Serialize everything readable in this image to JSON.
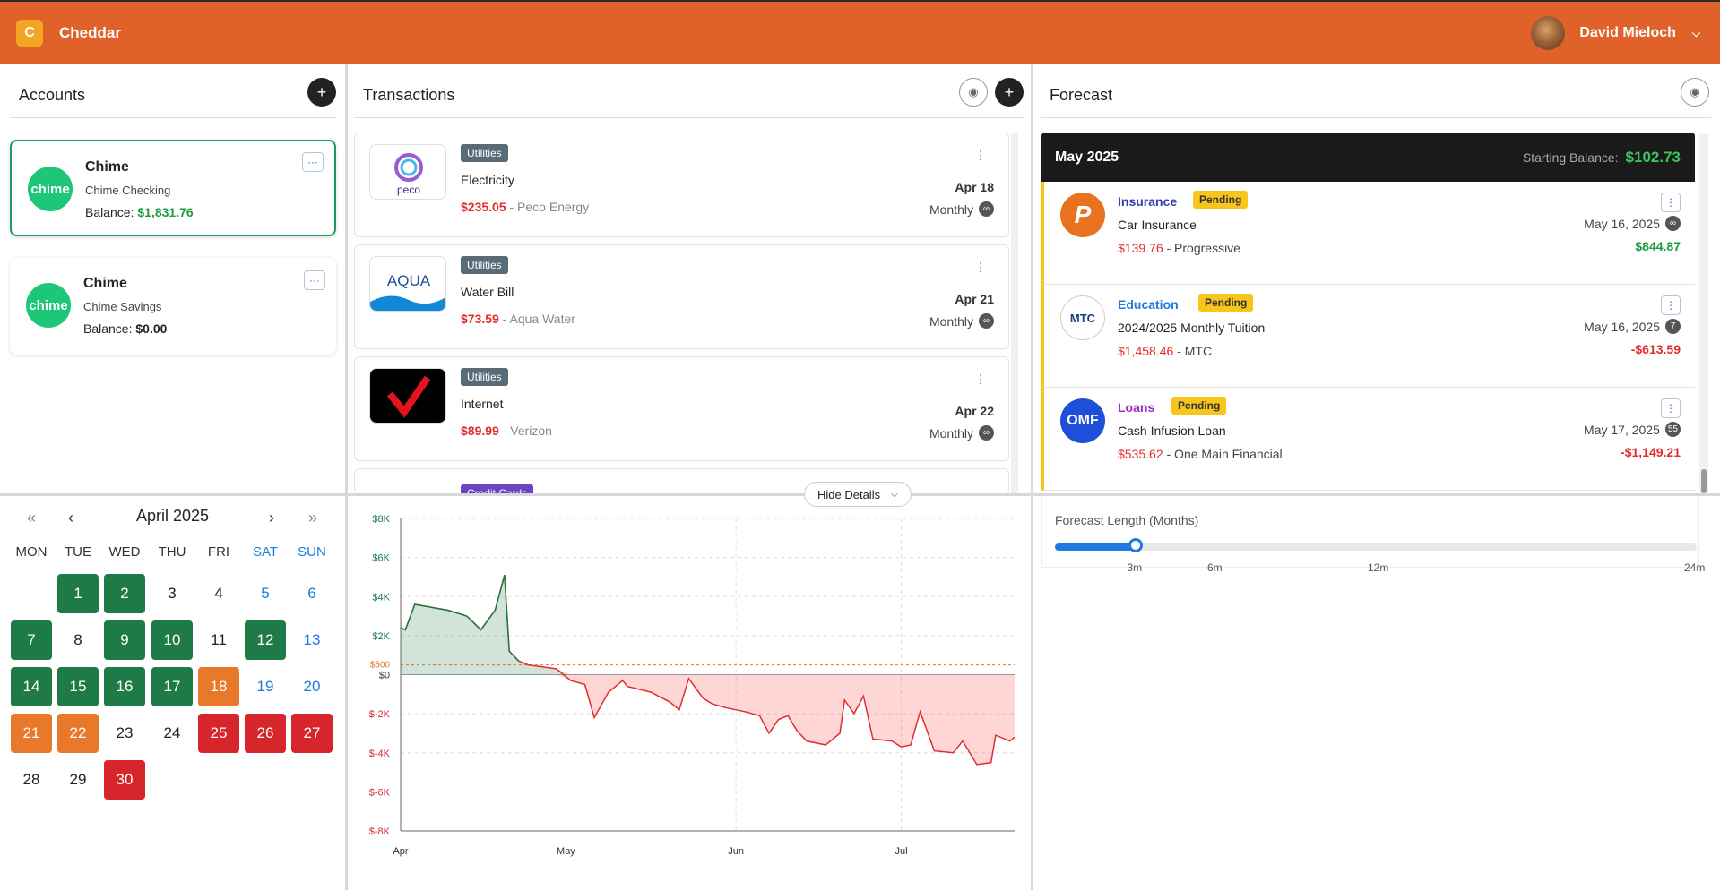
{
  "app": {
    "name": "Cheddar",
    "logo_icon": "cheddar-logo-icon"
  },
  "user": {
    "name": "David Mieloch"
  },
  "accounts": {
    "title": "Accounts",
    "add_label": "+",
    "items": [
      {
        "name": "Chime",
        "logo": "chime",
        "type": "Chime Checking",
        "balance_label": "Balance:",
        "balance": "$1,831.76",
        "selected": true
      },
      {
        "name": "Chime",
        "logo": "chime",
        "type": "Chime Savings",
        "balance_label": "Balance:",
        "balance": "$0.00",
        "selected": false
      }
    ],
    "menu_label": "···"
  },
  "transactions": {
    "title": "Transactions",
    "add_label": "+",
    "items": [
      {
        "logo_text": "peco",
        "category": "Utilities",
        "title": "Electricity",
        "amount": "$235.05",
        "payee": "- Peco Energy",
        "date": "Apr 18",
        "frequency": "Monthly",
        "count": "∞"
      },
      {
        "logo_text": "AQUA",
        "category": "Utilities",
        "title": "Water Bill",
        "amount": "$73.59",
        "payee": "- Aqua Water",
        "date": "Apr 21",
        "frequency": "Monthly",
        "count": "∞"
      },
      {
        "logo_text": "✓",
        "category": "Utilities",
        "title": "Internet",
        "amount": "$89.99",
        "payee": "- Verizon",
        "date": "Apr 22",
        "frequency": "Monthly",
        "count": "∞"
      },
      {
        "category": "Credit Cards"
      }
    ],
    "hide_details_label": "Hide Details"
  },
  "forecast": {
    "title": "Forecast",
    "month": "May 2025",
    "starting_balance_label": "Starting Balance:",
    "starting_balance": "$102.73",
    "items": [
      {
        "logo_text": "P",
        "category": "Insurance",
        "category_color": "#2f3fb0",
        "status": "Pending",
        "title": "Car Insurance",
        "amount": "$139.76",
        "payee": "- Progressive",
        "date": "May 16, 2025",
        "count": "∞",
        "balance": "$844.87",
        "balance_color": "#1c9c3c"
      },
      {
        "logo_text": "MTC",
        "category": "Education",
        "category_color": "#1f7ae0",
        "status": "Pending",
        "title": "2024/2025 Monthly Tuition",
        "amount": "$1,458.46",
        "payee": "- MTC",
        "date": "May 16, 2025",
        "count": "7",
        "balance": "-$613.59",
        "balance_color": "#e12d2d"
      },
      {
        "logo_text": "OMF",
        "category": "Loans",
        "category_color": "#9b2fc0",
        "status": "Pending",
        "title": "Cash Infusion Loan",
        "amount": "$535.62",
        "payee": "- One Main Financial",
        "date": "May 17, 2025",
        "count": "55",
        "balance": "-$1,149.21",
        "balance_color": "#e12d2d"
      }
    ],
    "length_label": "Forecast Length (Months)",
    "length_value_months": 3,
    "length_marks": [
      "3m",
      "6m",
      "12m",
      "24m"
    ]
  },
  "calendar": {
    "month": "April 2025",
    "nav": {
      "first": "«",
      "prev": "‹",
      "next": "›",
      "last": "»"
    },
    "weekdays": [
      "MON",
      "TUE",
      "WED",
      "THU",
      "FRI",
      "SAT",
      "SUN"
    ],
    "days": [
      {
        "d": "1",
        "s": "green"
      },
      {
        "d": "2",
        "s": "green"
      },
      {
        "d": "3",
        "s": ""
      },
      {
        "d": "4",
        "s": ""
      },
      {
        "d": "5",
        "s": "weekend"
      },
      {
        "d": "6",
        "s": "weekend"
      },
      {
        "d": "7",
        "s": "green"
      },
      {
        "d": "8",
        "s": ""
      },
      {
        "d": "9",
        "s": "green"
      },
      {
        "d": "10",
        "s": "green"
      },
      {
        "d": "11",
        "s": ""
      },
      {
        "d": "12",
        "s": "green"
      },
      {
        "d": "13",
        "s": "weekend"
      },
      {
        "d": "14",
        "s": "green"
      },
      {
        "d": "15",
        "s": "green"
      },
      {
        "d": "16",
        "s": "green"
      },
      {
        "d": "17",
        "s": "green"
      },
      {
        "d": "18",
        "s": "orange"
      },
      {
        "d": "19",
        "s": "weekend"
      },
      {
        "d": "20",
        "s": "weekend"
      },
      {
        "d": "21",
        "s": "orange"
      },
      {
        "d": "22",
        "s": "orange"
      },
      {
        "d": "23",
        "s": ""
      },
      {
        "d": "24",
        "s": ""
      },
      {
        "d": "25",
        "s": "red"
      },
      {
        "d": "26",
        "s": "red"
      },
      {
        "d": "27",
        "s": "red"
      },
      {
        "d": "28",
        "s": ""
      },
      {
        "d": "29",
        "s": ""
      },
      {
        "d": "30",
        "s": "red"
      }
    ],
    "first_weekday_index": 1
  },
  "chart_data": {
    "type": "area",
    "y_ticks": [
      "$8K",
      "$6K",
      "$4K",
      "$2K",
      "$0",
      "$-2K",
      "$-4K",
      "$-6K",
      "$-8K"
    ],
    "ylim": [
      -8000,
      8000
    ],
    "x_ticks": [
      "Apr",
      "May",
      "Jun",
      "Jul"
    ],
    "threshold_label": "$500",
    "threshold": 500,
    "series": [
      {
        "x": [
          0,
          1,
          3,
          10,
          14,
          17,
          20,
          22,
          23,
          25,
          27,
          30,
          33,
          36,
          39,
          41,
          44,
          47,
          48,
          53,
          57,
          59,
          61,
          64,
          66,
          69,
          73,
          76,
          78,
          80,
          82,
          84,
          86,
          90,
          93,
          94,
          96,
          98,
          100,
          104,
          106,
          108,
          110,
          113,
          117,
          119,
          121,
          122,
          125,
          126,
          129,
          130
        ],
        "y": [
          2400,
          2300,
          3600,
          3300,
          3000,
          2300,
          3300,
          5100,
          1200,
          700,
          500,
          400,
          300,
          -300,
          -500,
          -2200,
          -900,
          -300,
          -600,
          -900,
          -1400,
          -1800,
          -200,
          -1200,
          -1500,
          -1700,
          -1900,
          -2100,
          -3000,
          -2300,
          -2100,
          -2900,
          -3400,
          -3600,
          -3000,
          -1300,
          -2000,
          -1100,
          -3300,
          -3400,
          -3700,
          -3600,
          -1900,
          -3900,
          -4000,
          -3400,
          -4200,
          -4600,
          -4500,
          -3100,
          -3400,
          -3200
        ]
      }
    ]
  }
}
